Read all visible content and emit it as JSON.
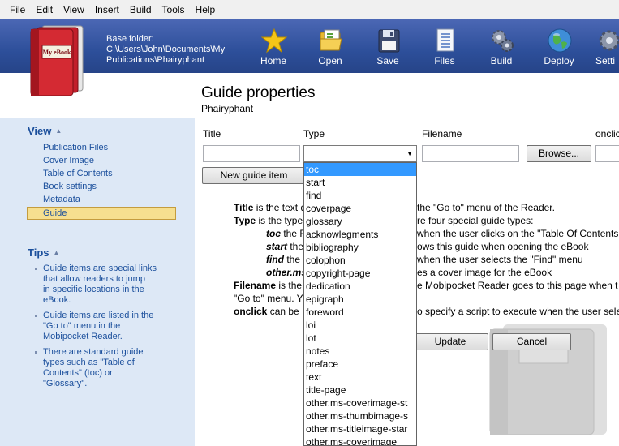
{
  "menu": [
    "File",
    "Edit",
    "View",
    "Insert",
    "Build",
    "Tools",
    "Help"
  ],
  "logo": {
    "text": "My eBook"
  },
  "base_folder": {
    "label": "Base folder:",
    "line1": "C:\\Users\\John\\Documents\\My",
    "line2": "Publications\\Phairyphant"
  },
  "toolbar": [
    {
      "label": "Home",
      "icon": "star-icon"
    },
    {
      "label": "Open",
      "icon": "open-folder-icon"
    },
    {
      "label": "Save",
      "icon": "floppy-disk-icon"
    },
    {
      "label": "Files",
      "icon": "files-icon"
    },
    {
      "label": "Build",
      "icon": "gears-icon"
    },
    {
      "label": "Deploy",
      "icon": "globe-icon"
    },
    {
      "label": "Setti",
      "icon": "settings-gear-icon"
    }
  ],
  "heading": {
    "title": "Guide properties",
    "subtitle": "Phairyphant"
  },
  "sidebar": {
    "view_title": "View",
    "view_items": [
      "Publication Files",
      "Cover Image",
      "Table of Contents",
      "Book settings",
      "Metadata",
      "Guide"
    ],
    "selected_index": 5,
    "tips_title": "Tips",
    "tips": [
      [
        "Guide items are special links",
        "that allow readers to jump",
        "in specific locations in the",
        "eBook."
      ],
      [
        "Guide items are listed in the",
        "\"Go to\" menu in the",
        "Mobipocket Reader."
      ],
      [
        "There are standard guide",
        "types such as \"Table of",
        "Contents\" (toc) or",
        "\"Glossary\"."
      ]
    ]
  },
  "form": {
    "col_title": "Title",
    "col_type": "Type",
    "col_filename": "Filename",
    "col_onclick": "onclic",
    "browse": "Browse...",
    "new_item": "New guide item",
    "update": "Update",
    "cancel": "Cancel"
  },
  "help": {
    "l1a": "Title",
    "l1b": " is the text d",
    "l1c": "the \"Go to\" menu of the Reader.",
    "l2a": "Type",
    "l2b": " is the type",
    "l2c": "re four special guide types:",
    "l3a": "toc",
    "l3b": " the F",
    "l3c": "when the user clicks on the \"Table Of Contents",
    "l4a": "start",
    "l4b": " the",
    "l4c": "ows this guide when opening the eBook",
    "l5a": "find",
    "l5b": " the I",
    "l5c": "when the user selects the \"Find\" menu",
    "l6a": "other.ms",
    "l6c": "es a cover image for the eBook",
    "l7a": "Filename",
    "l7b": " is the",
    "l7c": "e Mobipocket Reader goes to this page when t",
    "l8": "\"Go to\" menu. Y",
    "l9a": "onclick",
    "l9b": " can be",
    "l9c": "o specify a script to execute when the user sele"
  },
  "dropdown": {
    "selected": "toc",
    "options": [
      "toc",
      "start",
      "find",
      "coverpage",
      "glossary",
      "acknowlegments",
      "bibliography",
      "colophon",
      "copyright-page",
      "dedication",
      "epigraph",
      "foreword",
      "loi",
      "lot",
      "notes",
      "preface",
      "text",
      "title-page",
      "other.ms-coverimage-st",
      "other.ms-thumbimage-s",
      "other.ms-titleimage-star",
      "other.ms-coverimage"
    ]
  },
  "colors": {
    "toolbar_blue": "#2d4f9a",
    "sidebar_bg": "#dde8f6",
    "link_blue": "#1b4f9c",
    "selection_yellow": "#f6df8f",
    "list_highlight": "#3399ff"
  }
}
